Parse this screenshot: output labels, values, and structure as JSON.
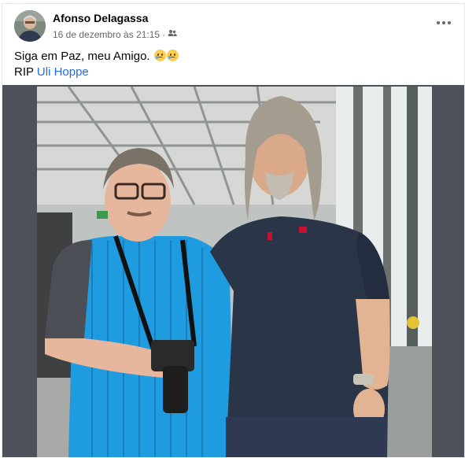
{
  "post": {
    "author": "Afonso Delagassa",
    "date": "16 de dezembro às 21:15",
    "separator": "·",
    "audience_icon": "friends-icon",
    "more_icon": "more-horizontal-icon",
    "text_line1": "Siga em Paz, meu Amigo.",
    "text_line2_prefix": "RIP",
    "tagged_person": "Uli Hoppe",
    "emoji": "crying-face",
    "colors": {
      "text": "#050505",
      "meta": "#65676b",
      "link": "#216fdb",
      "photo_background": "#4d5159"
    }
  }
}
